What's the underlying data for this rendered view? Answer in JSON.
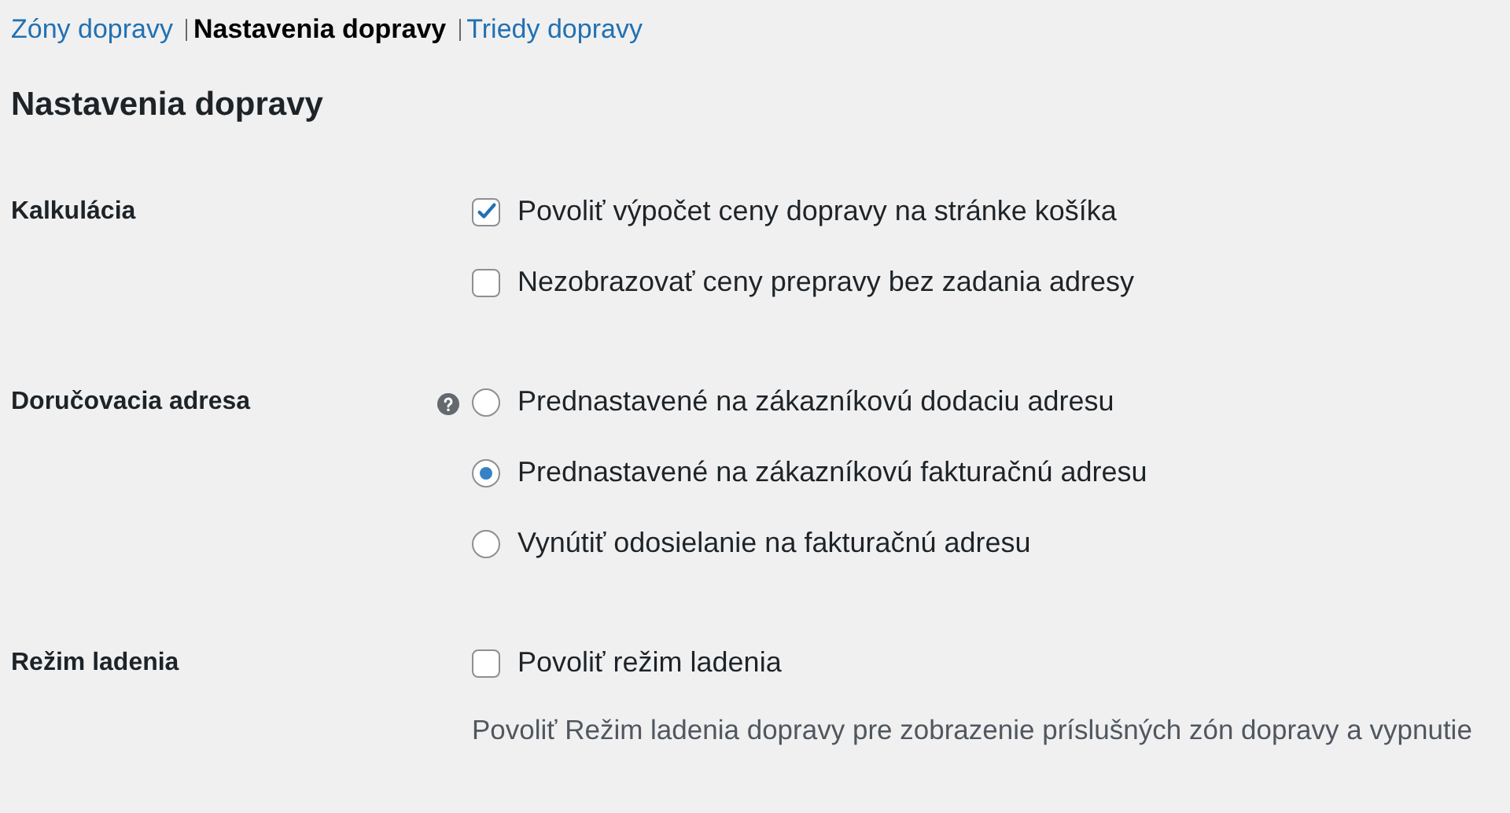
{
  "tabs": [
    {
      "label": "Zóny dopravy",
      "selected": false
    },
    {
      "label": "Nastavenia dopravy",
      "selected": true
    },
    {
      "label": "Triedy dopravy",
      "selected": false
    }
  ],
  "heading": "Nastavenia dopravy",
  "sections": [
    {
      "label": "Kalkulácia",
      "help": false,
      "options": [
        {
          "kind": "checkbox",
          "label": "Povoliť výpočet ceny dopravy na stránke košíka",
          "checked": true
        },
        {
          "kind": "checkbox",
          "label": "Nezobrazovať ceny prepravy bez zadania adresy",
          "checked": false
        }
      ]
    },
    {
      "label": "Doručovacia adresa",
      "help": true,
      "options": [
        {
          "kind": "radio",
          "label": "Prednastavené na zákazníkovú dodaciu adresu",
          "selected": false
        },
        {
          "kind": "radio",
          "label": "Prednastavené na zákazníkovú fakturačnú adresu",
          "selected": true
        },
        {
          "kind": "radio",
          "label": "Vynútiť odosielanie na fakturačnú adresu",
          "selected": false
        }
      ]
    },
    {
      "label": "Režim ladenia",
      "help": false,
      "options": [
        {
          "kind": "checkbox",
          "label": "Povoliť režim ladenia",
          "checked": false
        }
      ],
      "description": "Povoliť Režim ladenia dopravy pre zobrazenie príslušných zón dopravy a vypnutie"
    }
  ]
}
